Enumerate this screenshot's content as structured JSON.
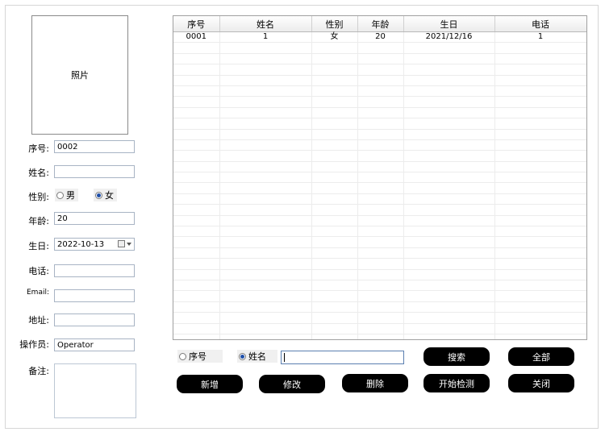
{
  "photo": {
    "label": "照片"
  },
  "form": {
    "seq": {
      "label": "序号:",
      "value": "0002"
    },
    "name": {
      "label": "姓名:",
      "value": ""
    },
    "gender": {
      "label": "性别:",
      "options": [
        "男",
        "女"
      ],
      "selected": "女"
    },
    "age": {
      "label": "年龄:",
      "value": "20"
    },
    "birthday": {
      "label": "生日:",
      "value": "2022-10-13"
    },
    "phone": {
      "label": "电话:",
      "value": ""
    },
    "email": {
      "label": "Email:",
      "value": ""
    },
    "address": {
      "label": "地址:",
      "value": ""
    },
    "operator": {
      "label": "操作员:",
      "value": "Operator"
    },
    "remark": {
      "label": "备注:",
      "value": ""
    }
  },
  "table": {
    "columns": [
      "序号",
      "姓名",
      "性别",
      "年龄",
      "生日",
      "电话"
    ],
    "rows": [
      [
        "0001",
        "1",
        "女",
        "20",
        "2021/12/16",
        "1"
      ]
    ]
  },
  "search": {
    "options": [
      "序号",
      "姓名"
    ],
    "selected": "姓名",
    "value": ""
  },
  "buttons": {
    "search": "搜索",
    "all": "全部",
    "add": "新增",
    "edit": "修改",
    "delete": "删除",
    "start_detect": "开始检测",
    "close": "关闭"
  }
}
